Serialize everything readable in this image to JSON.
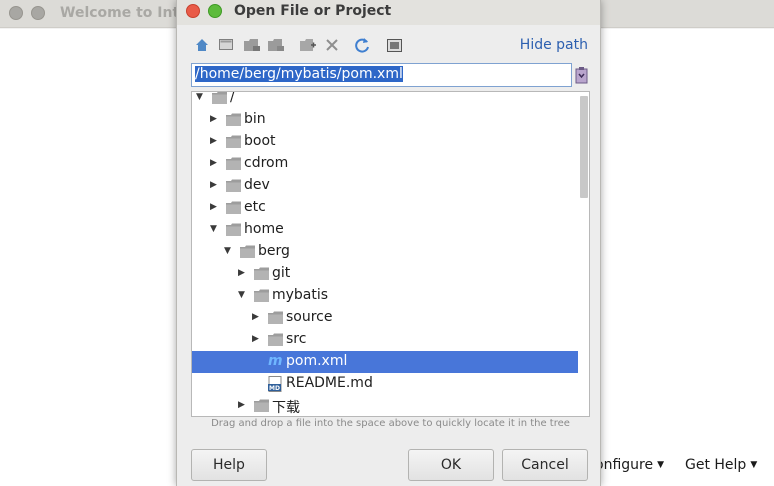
{
  "background_window": {
    "title": "Welcome to Inte",
    "configure_label": "Configure",
    "configure_prefix": "onfigure",
    "get_help_label": "Get Help"
  },
  "dialog": {
    "title": "Open File or Project",
    "hide_path_label": "Hide path",
    "path_value": "/home/berg/mybatis/pom.xml",
    "toolbar_icons": [
      "home-icon",
      "desktop-icon",
      "project-folder-icon",
      "module-folder-icon",
      "new-folder-icon",
      "delete-icon",
      "refresh-icon",
      "show-hidden-icon"
    ],
    "tree": [
      {
        "label": "/",
        "depth": 0,
        "expanded": true,
        "type": "folder"
      },
      {
        "label": "bin",
        "depth": 1,
        "expanded": false,
        "type": "folder"
      },
      {
        "label": "boot",
        "depth": 1,
        "expanded": false,
        "type": "folder"
      },
      {
        "label": "cdrom",
        "depth": 1,
        "expanded": false,
        "type": "folder"
      },
      {
        "label": "dev",
        "depth": 1,
        "expanded": false,
        "type": "folder"
      },
      {
        "label": "etc",
        "depth": 1,
        "expanded": false,
        "type": "folder"
      },
      {
        "label": "home",
        "depth": 1,
        "expanded": true,
        "type": "folder"
      },
      {
        "label": "berg",
        "depth": 2,
        "expanded": true,
        "type": "folder"
      },
      {
        "label": "git",
        "depth": 3,
        "expanded": false,
        "type": "folder"
      },
      {
        "label": "mybatis",
        "depth": 3,
        "expanded": true,
        "type": "folder"
      },
      {
        "label": "source",
        "depth": 4,
        "expanded": false,
        "type": "folder"
      },
      {
        "label": "src",
        "depth": 4,
        "expanded": false,
        "type": "folder"
      },
      {
        "label": "pom.xml",
        "depth": 4,
        "type": "maven-file",
        "selected": true
      },
      {
        "label": "README.md",
        "depth": 4,
        "type": "markdown-file"
      },
      {
        "label": "下载",
        "depth": 3,
        "expanded": false,
        "type": "folder"
      }
    ],
    "hint": "Drag and drop a file into the space above to quickly locate it in the tree",
    "help_label": "Help",
    "ok_label": "OK",
    "cancel_label": "Cancel"
  },
  "colors": {
    "selection": "#4876d9",
    "link": "#2c5fb0",
    "close_button": "#e95b48",
    "maximize_button": "#5dbb3c"
  }
}
